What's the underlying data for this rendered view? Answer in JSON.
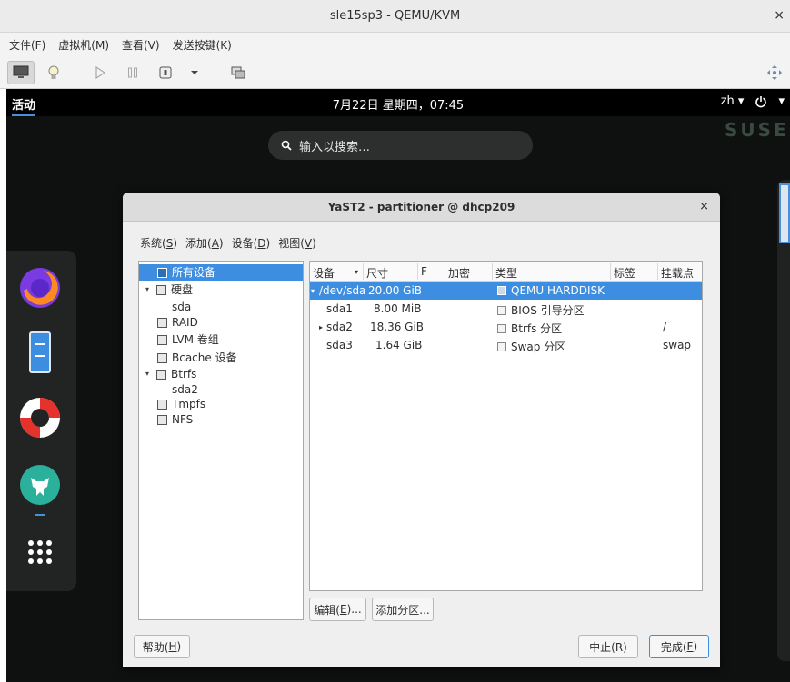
{
  "qemu": {
    "title": "sle15sp3 - QEMU/KVM",
    "close": "×",
    "menu": [
      "文件(F)",
      "虚拟机(M)",
      "查看(V)",
      "发送按键(K)"
    ]
  },
  "gnome": {
    "activities": "活动",
    "clock": "7月22日 星期四，07:45",
    "lang": "zh",
    "watermark": "SUSE",
    "search_placeholder": "输入以搜索…"
  },
  "yast": {
    "title": "YaST2 - partitioner @ dhcp209",
    "close": "×",
    "menu": [
      {
        "label": "系统(",
        "key": "S",
        "tail": ")"
      },
      {
        "label": "添加(",
        "key": "A",
        "tail": ")"
      },
      {
        "label": "设备(",
        "key": "D",
        "tail": ")"
      },
      {
        "label": "视图(",
        "key": "V",
        "tail": ")"
      }
    ],
    "tree": [
      {
        "label": "所有设备",
        "depth": 0,
        "icon": true,
        "caret": "",
        "selected": true
      },
      {
        "label": "硬盘",
        "depth": 0,
        "icon": true,
        "caret": "▾",
        "selected": false
      },
      {
        "label": "sda",
        "depth": 1,
        "icon": false,
        "caret": "",
        "selected": false
      },
      {
        "label": "RAID",
        "depth": 0,
        "icon": true,
        "caret": "",
        "selected": false
      },
      {
        "label": "LVM 卷组",
        "depth": 0,
        "icon": true,
        "caret": "",
        "selected": false
      },
      {
        "label": "Bcache 设备",
        "depth": 0,
        "icon": true,
        "caret": "",
        "selected": false
      },
      {
        "label": "Btrfs",
        "depth": 0,
        "icon": true,
        "caret": "▾",
        "selected": false
      },
      {
        "label": "sda2",
        "depth": 1,
        "icon": false,
        "caret": "",
        "selected": false
      },
      {
        "label": "Tmpfs",
        "depth": 0,
        "icon": true,
        "caret": "",
        "selected": false
      },
      {
        "label": "NFS",
        "depth": 0,
        "icon": true,
        "caret": "",
        "selected": false
      }
    ],
    "columns": [
      "设备",
      "尺寸",
      "F",
      "加密",
      "类型",
      "标签",
      "挂载点"
    ],
    "rows": [
      {
        "caret": "▾",
        "device": "/dev/sda",
        "size": "20.00 GiB",
        "type": "QEMU HARDDISK",
        "label": "",
        "mount": "",
        "selected": true
      },
      {
        "caret": "",
        "device": "sda1",
        "size": "8.00 MiB",
        "type": "BIOS 引导分区",
        "label": "",
        "mount": "",
        "selected": false
      },
      {
        "caret": "▸",
        "device": "sda2",
        "size": "18.36 GiB",
        "type": "Btrfs 分区",
        "label": "",
        "mount": "/",
        "selected": false
      },
      {
        "caret": "",
        "device": "sda3",
        "size": "1.64 GiB",
        "type": "Swap 分区",
        "label": "",
        "mount": "swap",
        "selected": false
      }
    ],
    "buttons": {
      "edit": {
        "label": "编辑(",
        "key": "E",
        "tail": ")..."
      },
      "add_partition": "添加分区...",
      "help": {
        "label": "帮助(",
        "key": "H",
        "tail": ")"
      },
      "abort": "中止(R)",
      "finish": {
        "label": "完成(",
        "key": "F",
        "tail": ")"
      }
    }
  },
  "colors": {
    "accent": "#3d8ee0",
    "guest_bg": "#0e1110"
  }
}
